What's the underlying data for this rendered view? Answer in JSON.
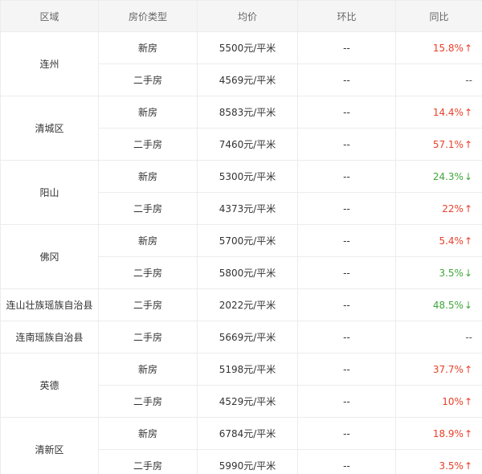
{
  "header": {
    "region": "区域",
    "type": "房价类型",
    "avg": "均价",
    "mom": "环比",
    "yoy": "同比"
  },
  "regions": [
    {
      "name": "连州",
      "rows": [
        {
          "type": "新房",
          "price": "5500元/平米",
          "mom": "--",
          "yoy": "15.8%",
          "dir": "up",
          "arrow": "↑"
        },
        {
          "type": "二手房",
          "price": "4569元/平米",
          "mom": "--",
          "yoy": "--",
          "dir": "flat",
          "arrow": ""
        }
      ]
    },
    {
      "name": "清城区",
      "rows": [
        {
          "type": "新房",
          "price": "8583元/平米",
          "mom": "--",
          "yoy": "14.4%",
          "dir": "up",
          "arrow": "↑"
        },
        {
          "type": "二手房",
          "price": "7460元/平米",
          "mom": "--",
          "yoy": "57.1%",
          "dir": "up",
          "arrow": "↑"
        }
      ]
    },
    {
      "name": "阳山",
      "rows": [
        {
          "type": "新房",
          "price": "5300元/平米",
          "mom": "--",
          "yoy": "24.3%",
          "dir": "down",
          "arrow": "↓"
        },
        {
          "type": "二手房",
          "price": "4373元/平米",
          "mom": "--",
          "yoy": "22%",
          "dir": "up",
          "arrow": "↑"
        }
      ]
    },
    {
      "name": "佛冈",
      "rows": [
        {
          "type": "新房",
          "price": "5700元/平米",
          "mom": "--",
          "yoy": "5.4%",
          "dir": "up",
          "arrow": "↑"
        },
        {
          "type": "二手房",
          "price": "5800元/平米",
          "mom": "--",
          "yoy": "3.5%",
          "dir": "down",
          "arrow": "↓"
        }
      ]
    },
    {
      "name": "连山壮族瑶族自治县",
      "rows": [
        {
          "type": "二手房",
          "price": "2022元/平米",
          "mom": "--",
          "yoy": "48.5%",
          "dir": "down",
          "arrow": "↓"
        }
      ]
    },
    {
      "name": "连南瑶族自治县",
      "rows": [
        {
          "type": "二手房",
          "price": "5669元/平米",
          "mom": "--",
          "yoy": "--",
          "dir": "flat",
          "arrow": ""
        }
      ]
    },
    {
      "name": "英德",
      "rows": [
        {
          "type": "新房",
          "price": "5198元/平米",
          "mom": "--",
          "yoy": "37.7%",
          "dir": "up",
          "arrow": "↑"
        },
        {
          "type": "二手房",
          "price": "4529元/平米",
          "mom": "--",
          "yoy": "10%",
          "dir": "up",
          "arrow": "↑"
        }
      ]
    },
    {
      "name": "清新区",
      "rows": [
        {
          "type": "新房",
          "price": "6784元/平米",
          "mom": "--",
          "yoy": "18.9%",
          "dir": "up",
          "arrow": "↑"
        },
        {
          "type": "二手房",
          "price": "5990元/平米",
          "mom": "--",
          "yoy": "3.5%",
          "dir": "up",
          "arrow": "↑"
        }
      ]
    }
  ],
  "colors": {
    "up": "#e8402a",
    "down": "#40a53a",
    "header_bg": "#f5f5f5",
    "border": "#ececec"
  }
}
